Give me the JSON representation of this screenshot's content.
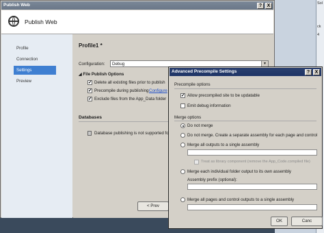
{
  "background_window": {
    "tab_labels": [
      "Sol",
      "ck",
      "4"
    ]
  },
  "publish_web": {
    "window_title": "Publish Web",
    "help_btn": "?",
    "close_btn": "X",
    "header_title": "Publish Web",
    "nav": [
      {
        "label": "Profile",
        "active": false
      },
      {
        "label": "Connection",
        "active": false
      },
      {
        "label": "Settings",
        "active": true
      },
      {
        "label": "Preview",
        "active": false
      }
    ],
    "profile_title": "Profile1 *",
    "configuration_label": "Configuration:",
    "configuration_value": "Debug",
    "file_publish_options": {
      "heading": "File Publish Options",
      "items": [
        {
          "label": "Delete all existing files prior to publish",
          "checked": true
        },
        {
          "label": "Precompile during publishing",
          "checked": true,
          "link": "Configure"
        },
        {
          "label": "Exclude files from the App_Data folder",
          "checked": true
        }
      ]
    },
    "databases": {
      "heading": "Databases",
      "message": "Database publishing is not supported for thi"
    },
    "prev_button": "< Prev"
  },
  "advanced_precompile": {
    "title": "Advanced Precompile Settings",
    "help_btn": "?",
    "close_btn": "X",
    "precompile_options_label": "Precompile options",
    "allow_updatable": {
      "label": "Allow precompiled site to be updatable",
      "checked": true
    },
    "emit_debug": {
      "label": "Emit debug information",
      "checked": false
    },
    "merge_options_label": "Merge options",
    "merge": [
      {
        "label": "Do not merge",
        "selected": true
      },
      {
        "label": "Do not merge. Create a separate assembly for each page and control",
        "selected": false
      },
      {
        "label": "Merge all outputs to a single assembly",
        "selected": false
      }
    ],
    "treat_as_library": "Treat as library component (remove the App_Code.compiled file)",
    "merge_folders": "Merge each individual folder output to its own assembly",
    "assembly_prefix_label": "Assembly prefix (optional):",
    "merge_pages": "Merge all pages and control outputs to a single assembly",
    "ok_button": "OK",
    "cancel_button": "Canc"
  }
}
